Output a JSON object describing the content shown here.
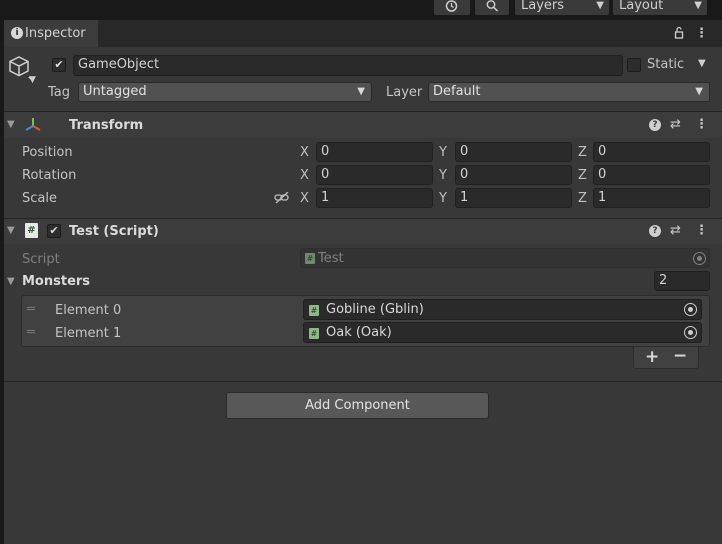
{
  "toolbar": {
    "layers_label": "Layers",
    "layout_label": "Layout"
  },
  "inspector": {
    "tab_label": "Inspector",
    "gameobject": {
      "name": "GameObject",
      "static_label": "Static",
      "tag_label": "Tag",
      "tag_value": "Untagged",
      "layer_label": "Layer",
      "layer_value": "Default"
    },
    "transform": {
      "title": "Transform",
      "rows": [
        {
          "label": "Position",
          "x": "0",
          "y": "0",
          "z": "0"
        },
        {
          "label": "Rotation",
          "x": "0",
          "y": "0",
          "z": "0"
        },
        {
          "label": "Scale",
          "x": "1",
          "y": "1",
          "z": "1"
        }
      ],
      "axis_x": "X",
      "axis_y": "Y",
      "axis_z": "Z"
    },
    "script_component": {
      "title": "Test (Script)",
      "script_label": "Script",
      "script_value": "Test",
      "monsters_label": "Monsters",
      "monsters_count": "2",
      "elements": [
        {
          "label": "Element 0",
          "value": "Gobline (Gblin)"
        },
        {
          "label": "Element 1",
          "value": "Oak (Oak)"
        }
      ]
    },
    "add_component_label": "Add Component"
  }
}
